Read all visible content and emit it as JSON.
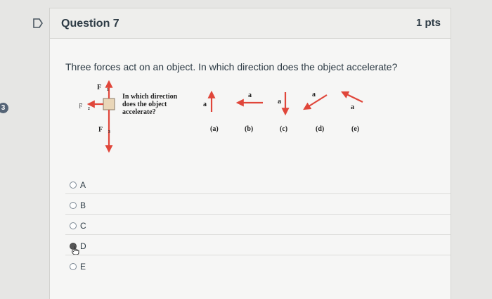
{
  "question": {
    "title": "Question 7",
    "points": "1 pts",
    "text": "Three forces act on an object. In which direction does the object accelerate?",
    "badge": "3"
  },
  "figure": {
    "prompt_lines": [
      "In which direction",
      "does the object",
      "accelerate?"
    ],
    "force_labels": [
      "F⃗₁",
      "F⃗₂",
      "F⃗₃"
    ],
    "vector_label": "a⃗",
    "choice_labels": [
      "(a)",
      "(b)",
      "(c)",
      "(d)",
      "(e)"
    ]
  },
  "answers": [
    {
      "label": "A",
      "selected": false
    },
    {
      "label": "B",
      "selected": false
    },
    {
      "label": "C",
      "selected": false
    },
    {
      "label": "D",
      "selected": true
    },
    {
      "label": "E",
      "selected": false
    }
  ],
  "colors": {
    "arrow_red": "#e0463a",
    "accent": "#2d3b45"
  },
  "icons": [
    "flag-icon",
    "cursor-hand-icon"
  ]
}
